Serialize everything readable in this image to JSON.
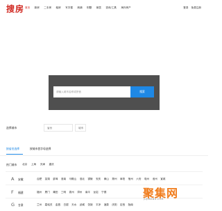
{
  "header": {
    "logo": "搜房",
    "nav": [
      "首页",
      "新房",
      "二手房",
      "租房",
      "写字楼",
      "商铺",
      "别墅",
      "家居",
      "查询/工具",
      "海外房产"
    ],
    "login": "登录",
    "register": "免费注册"
  },
  "search": {
    "placeholder": "请输入城市名称或拼音",
    "button": "搜索"
  },
  "choose": {
    "label": "选择城市",
    "province": "省份",
    "city": "城市"
  },
  "tabs": [
    "按省份选择",
    "按城市首字母选择"
  ],
  "hot": {
    "label": "热门城市",
    "cities": [
      "北京",
      "上海",
      "天津",
      "重庆"
    ]
  },
  "rows": [
    {
      "letter": "A",
      "province": "安徽",
      "cities": [
        "合肥",
        "芜湖",
        "蚌埠",
        "淮南",
        "马鞍山",
        "淮北",
        "铜陵",
        "安庆",
        "黄山",
        "滁州",
        "阜阳",
        "宿州",
        "六安",
        "亳州",
        "池州",
        "宣城"
      ]
    },
    {
      "letter": "F",
      "province": "福建",
      "cities": [
        "福州",
        "厦门",
        "莆田",
        "三明",
        "泉州",
        "漳州",
        "南平",
        "龙岩",
        "宁德"
      ]
    },
    {
      "letter": "G",
      "province": "甘肃",
      "cities": [
        "兰州",
        "嘉峪关",
        "金昌",
        "白银",
        "天水",
        "武威",
        "张掖",
        "平凉",
        "酒泉",
        "庆阳",
        "定西",
        "陇南"
      ]
    }
  ],
  "watermark": {
    "text": "聚集网",
    "sub": "JUJIWANG.COM"
  },
  "colors": {
    "brand": "#d0261f",
    "accent": "#1e88e5",
    "hero_bg": "#4f4f4f"
  }
}
